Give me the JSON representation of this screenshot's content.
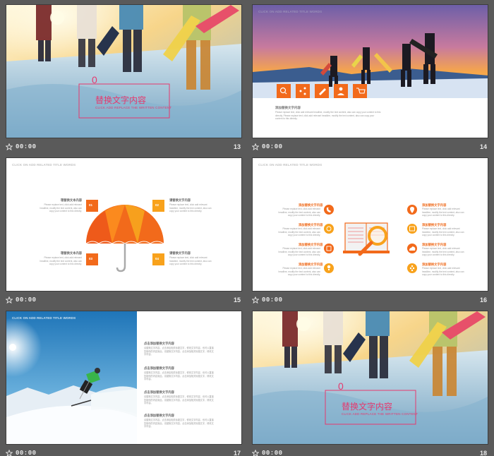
{
  "slides": [
    {
      "number": "13",
      "time": "00:00",
      "title_zero": "0",
      "title": "替换文字内容",
      "subtitle": "CLICK ADD REPLACE THE WRITTEN CONTENT"
    },
    {
      "number": "14",
      "time": "00:00",
      "header": "CLICK ON ADD RELATED TITLE WORDS",
      "text_title": "添加替换文字内容",
      "text_body": "Please replace text, click add relevant headline, modify the text content, also can copy your content to this directly. Please replace text, click add relevant headline, modify the text content, also can copy your content to this directly."
    },
    {
      "number": "15",
      "time": "00:00",
      "header": "CLICK ON ADD RELATED TITLE WORDS",
      "items": [
        {
          "num": "01",
          "title": "理替换文本内容",
          "body": "Please replace text, click add relevant headline, modify the text content, also can copy your content to this directly."
        },
        {
          "num": "02",
          "title": "请替换文字内容",
          "body": "Please replace text, click add relevant headline, modify the text content, also can copy your content to this directly."
        },
        {
          "num": "03",
          "title": "理替换文本内容",
          "body": "Please replace text, click add relevant headline, modify the text content, also can copy your content to this directly."
        },
        {
          "num": "04",
          "title": "请替换文字内容",
          "body": "Please replace text, click add relevant headline, modify the text content, also can copy your content to this directly."
        }
      ]
    },
    {
      "number": "16",
      "time": "00:00",
      "header": "CLICK ON ADD RELATED TITLE WORDS",
      "item_title": "添加替换文字内容",
      "item_body": "Please replace text, click add relevant headline, modify the text content, also can copy your content to this directly."
    },
    {
      "number": "17",
      "time": "00:00",
      "header": "CLICK ON ADD RELATED TITLE WORDS",
      "para_title": "点击添加替换文字内容",
      "para_body": "请替换文字内容，点击添加相关标题文字，修改文字内容，也可以直接复制你的内容到此。请替换文字内容，点击添加相关标题文字，修改文字内容。"
    },
    {
      "number": "18",
      "time": "00:00",
      "title_zero": "0",
      "title": "替换文字内容",
      "subtitle": "CLICK ADD REPLACE THE WRITTEN CONTENT"
    }
  ],
  "colors": {
    "accent": "#f26a1b",
    "pink": "#e5396e",
    "orange2": "#f8a21c"
  }
}
